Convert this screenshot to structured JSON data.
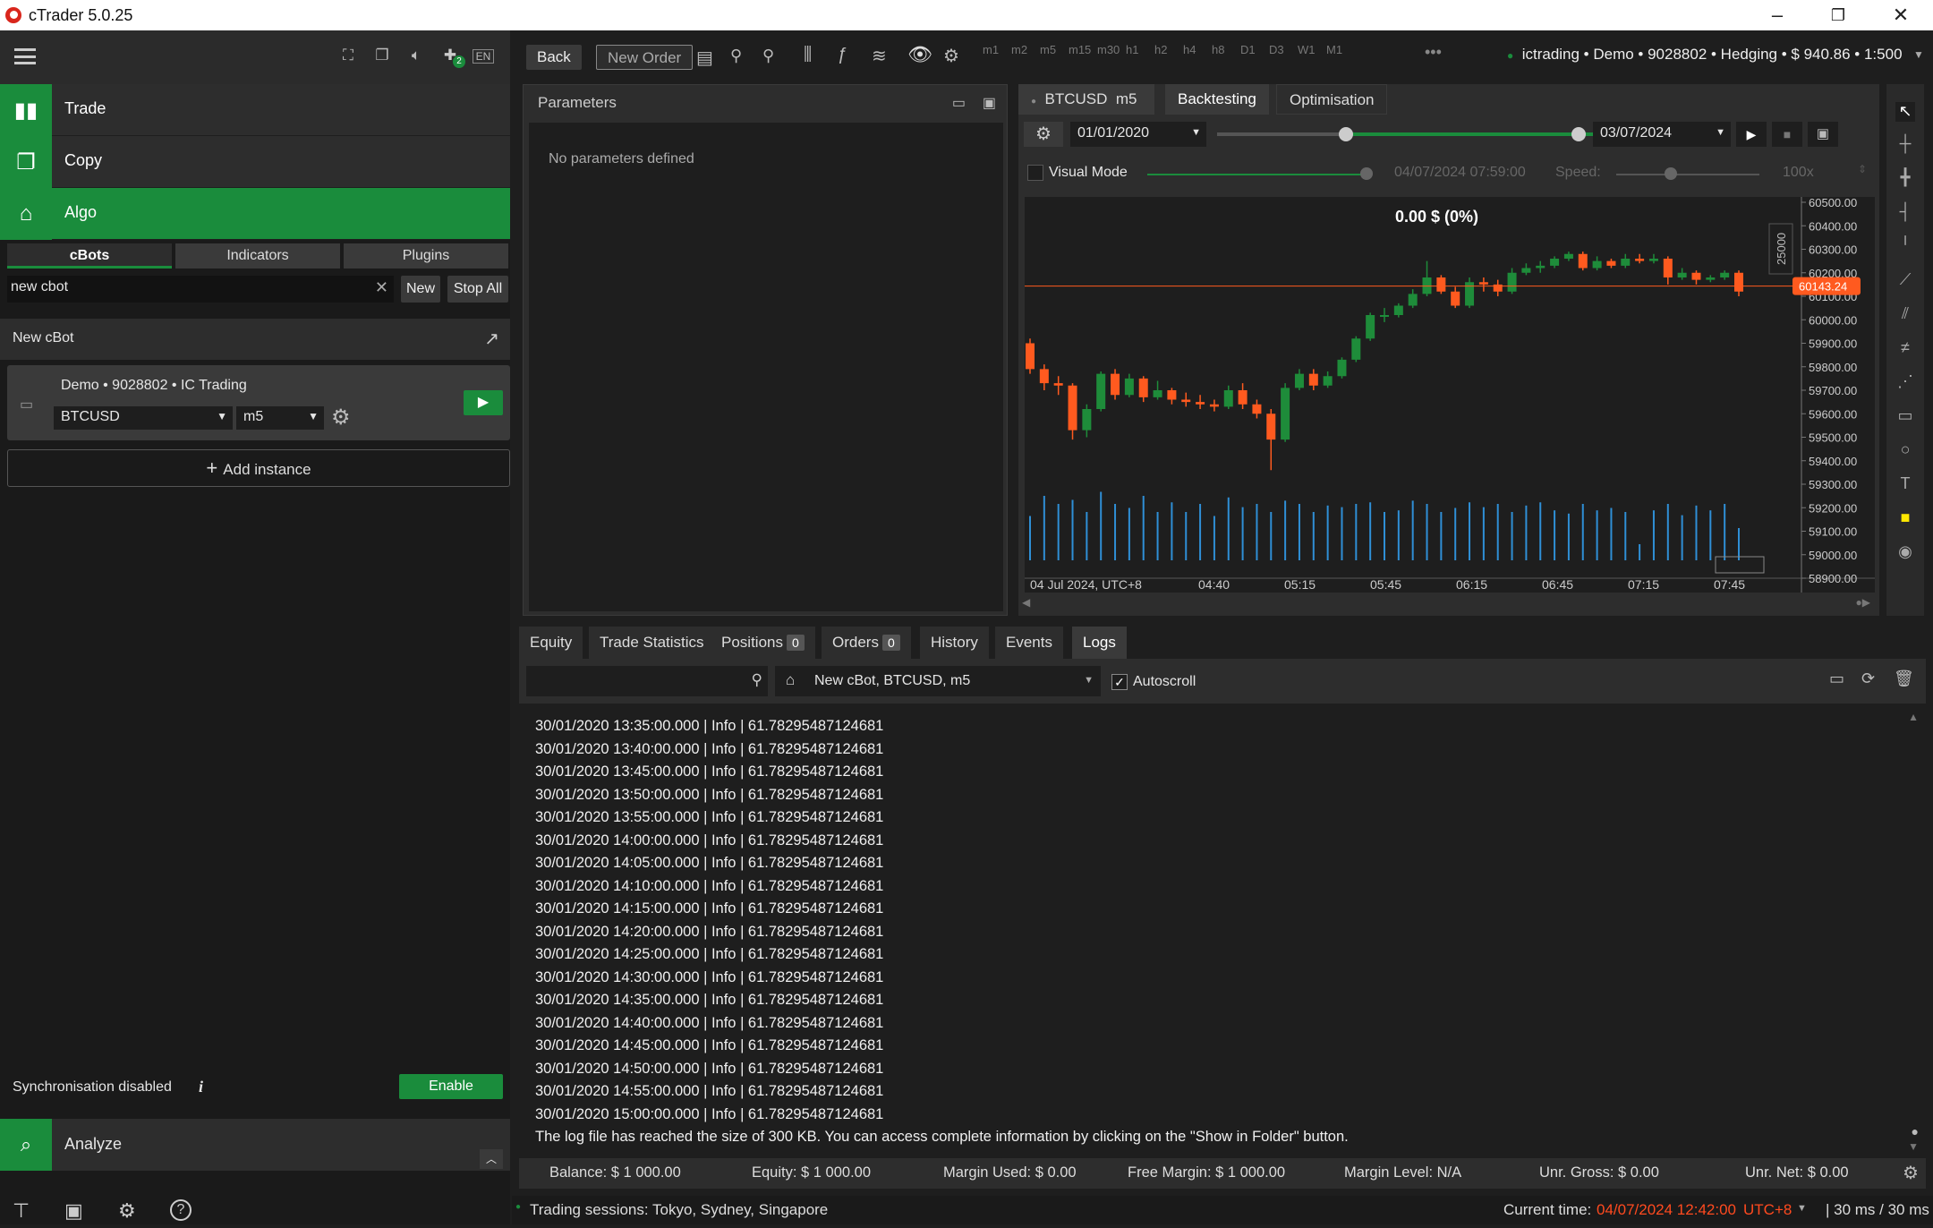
{
  "window": {
    "title": "cTrader 5.0.25"
  },
  "left": {
    "nav": {
      "trade": "Trade",
      "copy": "Copy",
      "algo": "Algo",
      "analyze": "Analyze"
    },
    "algo_tabs": [
      "cBots",
      "Indicators",
      "Plugins"
    ],
    "search": {
      "value": "new cbot"
    },
    "buttons": {
      "new": "New",
      "stop_all": "Stop All"
    },
    "group_title": "New cBot",
    "instance": {
      "account": "Demo • 9028802 •  IC Trading",
      "symbol": "BTCUSD",
      "timeframe": "m5"
    },
    "add_instance": "Add instance",
    "sync": {
      "text": "Synchronisation disabled",
      "button": "Enable"
    },
    "badge": "2",
    "lang": "EN"
  },
  "toolbar": {
    "back": "Back",
    "new_order": "New Order",
    "timeframes": [
      "m1",
      "m2",
      "m5",
      "m15",
      "m30",
      "h1",
      "h2",
      "h4",
      "h8",
      "D1",
      "D3",
      "W1",
      "M1"
    ],
    "account": "ictrading • Demo • 9028802 • Hedging • $ 940.86 • 1:500"
  },
  "parameters": {
    "title": "Parameters",
    "empty": "No parameters defined"
  },
  "chart_panel": {
    "symbol": "BTCUSD",
    "timeframe": "m5",
    "tabs": {
      "backtesting": "Backtesting",
      "optimisation": "Optimisation"
    },
    "start_date": "01/01/2020",
    "end_date": "03/07/2024",
    "visual_mode": "Visual Mode",
    "visual_time": "04/07/2024 07:59:00",
    "speed_label": "Speed:",
    "speed": "100x",
    "pnl": "0.00 $ (0%)",
    "volume_label": "25000",
    "price_label": "60143.24"
  },
  "chart_data": {
    "type": "candlestick",
    "x_ticks": [
      "04 Jul 2024, UTC+8",
      "04:40",
      "05:15",
      "05:45",
      "06:15",
      "06:45",
      "07:15",
      "07:45"
    ],
    "y_ticks": [
      "60500.00",
      "60400.00",
      "60300.00",
      "60200.00",
      "60100.00",
      "60000.00",
      "59900.00",
      "59800.00",
      "59700.00",
      "59600.00",
      "59500.00",
      "59400.00",
      "59300.00",
      "59200.00",
      "59100.00",
      "59000.00",
      "58900.00"
    ],
    "ylim": [
      58900,
      60500
    ],
    "current_price": 60143.24,
    "candles": [
      [
        59900,
        59790,
        59920,
        59770
      ],
      [
        59790,
        59730,
        59810,
        59700
      ],
      [
        59730,
        59720,
        59760,
        59680
      ],
      [
        59720,
        59530,
        59730,
        59490
      ],
      [
        59530,
        59620,
        59640,
        59500
      ],
      [
        59620,
        59770,
        59780,
        59610
      ],
      [
        59770,
        59680,
        59790,
        59660
      ],
      [
        59680,
        59750,
        59770,
        59670
      ],
      [
        59750,
        59670,
        59760,
        59650
      ],
      [
        59670,
        59700,
        59740,
        59660
      ],
      [
        59700,
        59660,
        59710,
        59640
      ],
      [
        59660,
        59650,
        59690,
        59630
      ],
      [
        59650,
        59640,
        59680,
        59620
      ],
      [
        59640,
        59630,
        59660,
        59610
      ],
      [
        59630,
        59700,
        59720,
        59620
      ],
      [
        59700,
        59640,
        59730,
        59620
      ],
      [
        59640,
        59600,
        59660,
        59580
      ],
      [
        59600,
        59490,
        59620,
        59360
      ],
      [
        59490,
        59710,
        59730,
        59480
      ],
      [
        59710,
        59770,
        59790,
        59700
      ],
      [
        59770,
        59720,
        59790,
        59700
      ],
      [
        59720,
        59760,
        59780,
        59710
      ],
      [
        59760,
        59830,
        59840,
        59750
      ],
      [
        59830,
        59920,
        59930,
        59820
      ],
      [
        59920,
        60020,
        60030,
        59910
      ],
      [
        60020,
        60020,
        60050,
        59990
      ],
      [
        60020,
        60060,
        60070,
        60010
      ],
      [
        60060,
        60110,
        60130,
        60050
      ],
      [
        60110,
        60180,
        60250,
        60100
      ],
      [
        60180,
        60120,
        60190,
        60110
      ],
      [
        60120,
        60060,
        60140,
        60050
      ],
      [
        60060,
        60160,
        60180,
        60050
      ],
      [
        60160,
        60150,
        60180,
        60120
      ],
      [
        60150,
        60120,
        60170,
        60100
      ],
      [
        60120,
        60200,
        60220,
        60110
      ],
      [
        60200,
        60220,
        60240,
        60190
      ],
      [
        60220,
        60230,
        60250,
        60200
      ],
      [
        60230,
        60260,
        60270,
        60220
      ],
      [
        60260,
        60280,
        60290,
        60250
      ],
      [
        60280,
        60220,
        60290,
        60210
      ],
      [
        60220,
        60250,
        60270,
        60210
      ],
      [
        60250,
        60230,
        60260,
        60220
      ],
      [
        60230,
        60260,
        60280,
        60220
      ],
      [
        60260,
        60250,
        60280,
        60240
      ],
      [
        60250,
        60260,
        60280,
        60240
      ],
      [
        60260,
        60180,
        60270,
        60150
      ],
      [
        60180,
        60200,
        60220,
        60170
      ],
      [
        60200,
        60170,
        60210,
        60150
      ],
      [
        60170,
        60180,
        60190,
        60160
      ],
      [
        60180,
        60200,
        60210,
        60170
      ],
      [
        60200,
        60120,
        60210,
        60100
      ]
    ],
    "volumes": [
      0.55,
      0.8,
      0.7,
      0.75,
      0.6,
      0.85,
      0.7,
      0.65,
      0.8,
      0.6,
      0.72,
      0.6,
      0.7,
      0.55,
      0.78,
      0.66,
      0.7,
      0.6,
      0.74,
      0.7,
      0.6,
      0.68,
      0.66,
      0.7,
      0.72,
      0.6,
      0.62,
      0.74,
      0.7,
      0.6,
      0.65,
      0.72,
      0.66,
      0.7,
      0.6,
      0.68,
      0.72,
      0.62,
      0.58,
      0.7,
      0.62,
      0.65,
      0.6,
      0.2,
      0.62,
      0.7,
      0.56,
      0.68,
      0.62,
      0.7,
      0.4
    ]
  },
  "bottom_tabs": {
    "equity": "Equity",
    "trade_statistics": "Trade Statistics",
    "positions": "Positions",
    "positions_count": "0",
    "orders": "Orders",
    "orders_count": "0",
    "history": "History",
    "events": "Events",
    "logs": "Logs"
  },
  "logs_bar": {
    "instance": "New cBot, BTCUSD, m5",
    "autoscroll": "Autoscroll"
  },
  "logs": [
    "30/01/2020 13:35:00.000 | Info | 61.78295487124681",
    "30/01/2020 13:40:00.000 | Info | 61.78295487124681",
    "30/01/2020 13:45:00.000 | Info | 61.78295487124681",
    "30/01/2020 13:50:00.000 | Info | 61.78295487124681",
    "30/01/2020 13:55:00.000 | Info | 61.78295487124681",
    "30/01/2020 14:00:00.000 | Info | 61.78295487124681",
    "30/01/2020 14:05:00.000 | Info | 61.78295487124681",
    "30/01/2020 14:10:00.000 | Info | 61.78295487124681",
    "30/01/2020 14:15:00.000 | Info | 61.78295487124681",
    "30/01/2020 14:20:00.000 | Info | 61.78295487124681",
    "30/01/2020 14:25:00.000 | Info | 61.78295487124681",
    "30/01/2020 14:30:00.000 | Info | 61.78295487124681",
    "30/01/2020 14:35:00.000 | Info | 61.78295487124681",
    "30/01/2020 14:40:00.000 | Info | 61.78295487124681",
    "30/01/2020 14:45:00.000 | Info | 61.78295487124681",
    "30/01/2020 14:50:00.000 | Info | 61.78295487124681",
    "30/01/2020 14:55:00.000 | Info | 61.78295487124681",
    "30/01/2020 15:00:00.000 | Info | 61.78295487124681",
    "The log file has reached the size of 300 KB. You can access complete information by clicking on the \"Show in Folder\" button."
  ],
  "status": {
    "balance": "Balance: $ 1 000.00",
    "equity": "Equity: $ 1 000.00",
    "margin_used": "Margin Used: $ 0.00",
    "free_margin": "Free Margin: $ 1 000.00",
    "margin_level": "Margin Level: N/A",
    "unr_gross": "Unr. Gross: $ 0.00",
    "unr_net": "Unr. Net: $ 0.00"
  },
  "footer": {
    "sessions": "Trading sessions: Tokyo, Sydney, Singapore",
    "current_label": "Current time:",
    "current_time": "04/07/2024 12:42:00",
    "tz": "UTC+8",
    "latency": "| 30 ms / 30 ms"
  },
  "colors": {
    "accent": "#1a8c3c",
    "bull": "#1e8c3a",
    "bear": "#ff5a1f",
    "volume": "#2f8fd6"
  }
}
